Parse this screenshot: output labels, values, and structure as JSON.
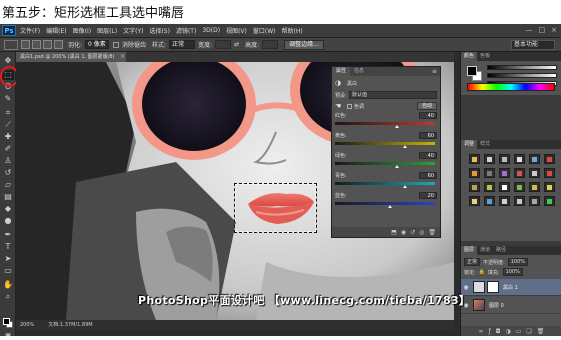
{
  "caption": "第五步：矩形选框工具选中嘴唇",
  "menubar": {
    "logo": "Ps",
    "items": [
      "文件(F)",
      "编辑(E)",
      "图像(I)",
      "图层(L)",
      "文字(Y)",
      "选择(S)",
      "滤镜(T)",
      "3D(D)",
      "视图(V)",
      "窗口(W)",
      "帮助(H)"
    ],
    "window_controls": [
      "—",
      "□",
      "×"
    ]
  },
  "options_bar": {
    "feather_label": "羽化:",
    "feather_value": "0 像素",
    "antialias_label": "消除锯齿",
    "style_label": "样式:",
    "style_value": "正常",
    "width_label": "宽度:",
    "height_label": "高度:",
    "refine_button": "调整边缘...",
    "workspace": "基本功能"
  },
  "document": {
    "tab_title": "黑白1.psd @ 200% (黑白 1, 图层蒙版/8)",
    "tab_close": "×",
    "zoom": "200%",
    "doc_info": "文档:1.37M/1.89M"
  },
  "properties_panel": {
    "tab_properties": "属性",
    "tab_info": "信息",
    "title_icon": "黑白",
    "preset_label": "预设:",
    "preset_value": "默认值",
    "tint_label": "色调",
    "auto_button": "自动",
    "sliders": [
      {
        "label": "红色:",
        "value": "40",
        "gradient": "#c0392b",
        "pct": 0.62
      },
      {
        "label": "黄色:",
        "value": "60",
        "gradient": "#c8b400",
        "pct": 0.7
      },
      {
        "label": "绿色:",
        "value": "40",
        "gradient": "#2e9e3b",
        "pct": 0.62
      },
      {
        "label": "青色:",
        "value": "60",
        "gradient": "#1fa7b8",
        "pct": 0.7
      },
      {
        "label": "蓝色:",
        "value": "20",
        "gradient": "#2c44c8",
        "pct": 0.55
      }
    ]
  },
  "right_panels": {
    "color_tab": "颜色",
    "swatches_tab": "色板",
    "adjust_tab": "调整",
    "styles_tab": "样式",
    "layers_tab": "图层",
    "channels_tab": "通道",
    "paths_tab": "路径",
    "blend_mode": "正常",
    "opacity_label": "不透明度:",
    "opacity_value": "100%",
    "fill_label": "填充:",
    "fill_value": "100%",
    "lock_label": "锁定:",
    "layers": [
      {
        "name": "黑白 1",
        "selected": true
      },
      {
        "name": "图层 0",
        "selected": false
      }
    ]
  },
  "watermark": "PhotoShop平面设计吧  【www.linecg.com/tieba/1783】",
  "colors": {
    "highlight_circle": "#e8191a",
    "panel_bg": "#535353",
    "app_bg": "#2b2b2b"
  }
}
